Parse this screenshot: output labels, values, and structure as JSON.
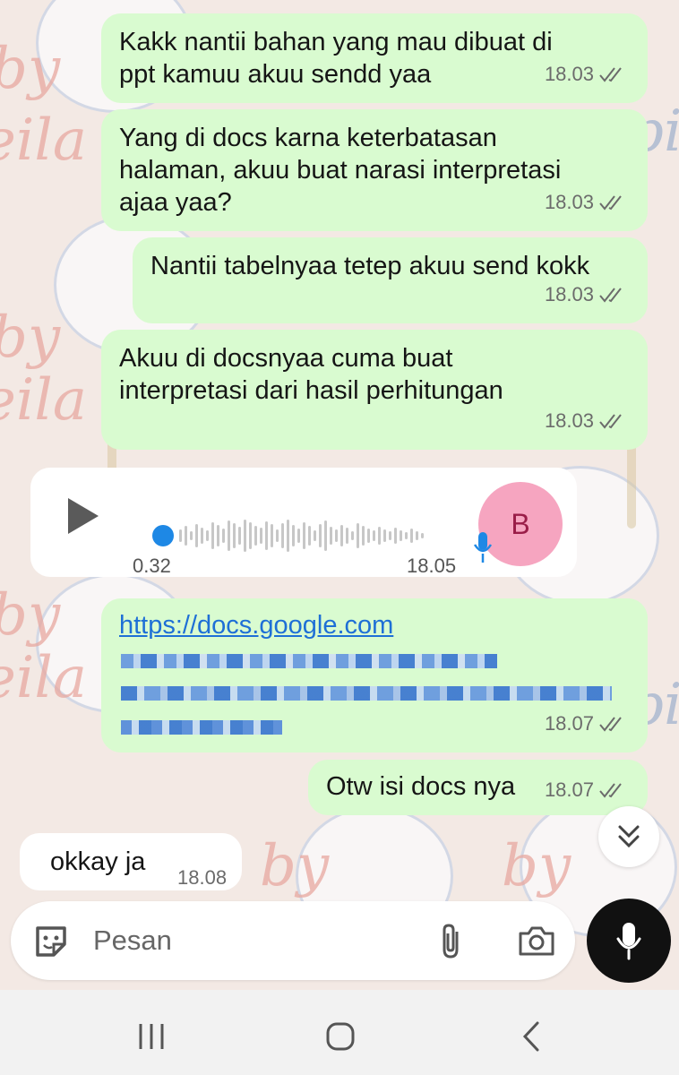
{
  "watermark": {
    "text_1": "by",
    "text_2": "eila",
    "text_3": "pi"
  },
  "messages": [
    {
      "id": "m1",
      "text": "Kakk nantii bahan yang mau dibuat di\nppt kamuu akuu sendd yaa",
      "time": "18.03"
    },
    {
      "id": "m2",
      "text": "Yang di docs karna keterbatasan\nhalaman, akuu buat narasi interpretasi\najaa yaa?",
      "time": "18.03"
    },
    {
      "id": "m3",
      "text": "Nantii tabelnyaa tetep akuu send kokk",
      "time": "18.03"
    },
    {
      "id": "m4",
      "text": "Akuu di docsnyaa cuma buat\ninterpretasi dari hasil perhitungan",
      "time": "18.03"
    }
  ],
  "voice_note": {
    "duration": "0.32",
    "time": "18.05",
    "avatar_initial": "B"
  },
  "link_message": {
    "url": "https://docs.google.com",
    "time": "18.07"
  },
  "otw_message": {
    "text": "Otw isi docs nya",
    "time": "18.07"
  },
  "incoming_message": {
    "text": "okkay ja",
    "time": "18.08"
  },
  "composer": {
    "placeholder": "Pesan"
  },
  "icons": {
    "sticker": "sticker-icon",
    "attach": "paperclip-icon",
    "camera": "camera-icon",
    "mic": "mic-icon",
    "scroll_down": "double-chevron-down-icon",
    "play": "play-icon",
    "read_receipt": "double-check-icon",
    "nav_recent": "recent-apps-icon",
    "nav_home": "home-icon",
    "nav_back": "back-icon"
  },
  "colors": {
    "outgoing_bubble": "#d9fbd0",
    "incoming_bubble": "#ffffff",
    "link": "#1e6fd6",
    "mic_button": "#111111",
    "avatar": "#f6a5c0"
  }
}
